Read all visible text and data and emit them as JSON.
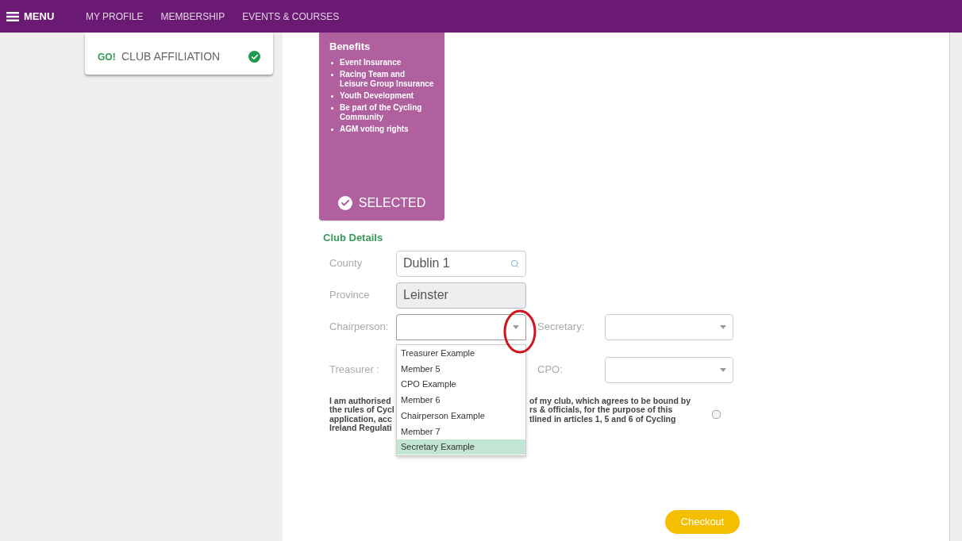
{
  "nav": {
    "menu_label": "MENU",
    "links": [
      {
        "label": "MY PROFILE"
      },
      {
        "label": "MEMBERSHIP"
      },
      {
        "label": "EVENTS & COURSES"
      }
    ]
  },
  "steps": [
    {
      "badge": "GO!",
      "label": "CLUB AFFILIATION",
      "done": true
    }
  ],
  "plan_card": {
    "title": "Benefits",
    "benefits": [
      "Event Insurance",
      "Racing Team and Leisure Group Insurance",
      "Youth Development",
      "Be part of the Cycling Community",
      "AGM voting rights"
    ],
    "selected": true,
    "selected_label": "SELECTED"
  },
  "club_details": {
    "heading": "Club Details",
    "county": {
      "label": "County",
      "value": "Dublin 1"
    },
    "province": {
      "label": "Province",
      "value": "Leinster"
    },
    "chairperson": {
      "label": "Chairperson:",
      "expanded": true
    },
    "secretary": {
      "label": "Secretary:"
    },
    "treasurer": {
      "label": "Treasurer :"
    },
    "cpo": {
      "label": "CPO:"
    },
    "options": [
      {
        "label": "Treasurer Example",
        "selected": false
      },
      {
        "label": "Member 5",
        "selected": false
      },
      {
        "label": "CPO Example",
        "selected": false
      },
      {
        "label": "Member 6",
        "selected": false
      },
      {
        "label": "Chairperson Example",
        "selected": false
      },
      {
        "label": "Member 7",
        "selected": false
      },
      {
        "label": "Secretary Example",
        "selected": true
      }
    ],
    "declaration_left": [
      "I am authorised",
      "the rules of Cycl",
      "application, acc",
      "Ireland Regulati"
    ],
    "declaration_right": [
      "of my club, which agrees to be bound by",
      "rs & officials, for the purpose of this",
      "tlined in articles 1, 5 and 6 of Cycling"
    ],
    "agreed": false
  },
  "checkout_label": "Checkout"
}
